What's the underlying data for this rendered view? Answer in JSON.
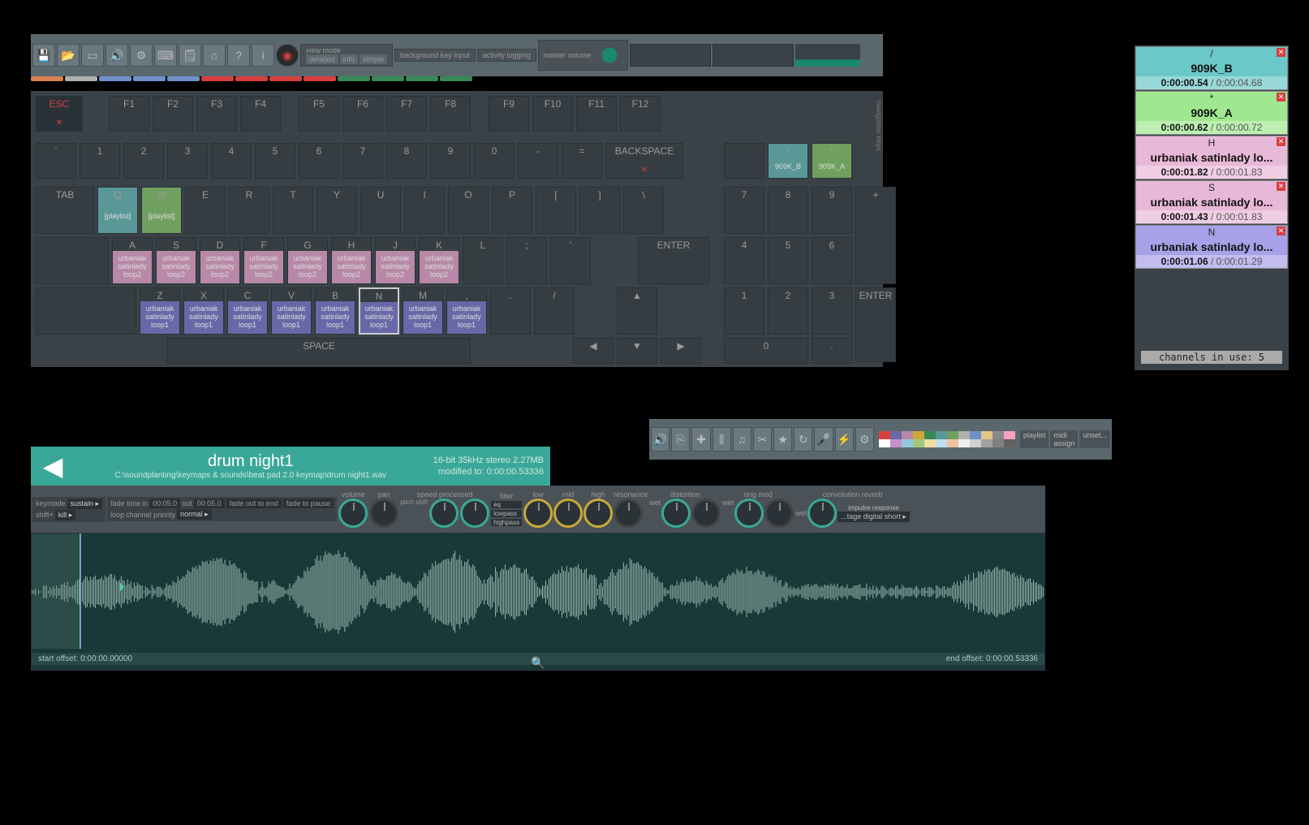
{
  "toolbar": {
    "view_mode_label": "view mode",
    "view_opts": [
      "detailed",
      "info",
      "simple"
    ],
    "bg_key_input": "background key input",
    "activity_logging": "activity logging",
    "master_volume": "master volume"
  },
  "fn_tabs": [
    "#d88050",
    "#b0b0b0",
    "#7090c8",
    "#7090c8",
    "#7090c8",
    "#d84040",
    "#d84040",
    "#d84040",
    "#d84040",
    "#388858",
    "#388858",
    "#388858",
    "#388858"
  ],
  "keyboard": {
    "esc": "ESC",
    "f_row": [
      "F1",
      "F2",
      "F3",
      "F4",
      "F5",
      "F6",
      "F7",
      "F8",
      "F9",
      "F10",
      "F11",
      "F12"
    ],
    "num_row": [
      "`",
      "1",
      "2",
      "3",
      "4",
      "5",
      "6",
      "7",
      "8",
      "9",
      "0",
      "-",
      "="
    ],
    "backspace": "BACKSPACE",
    "tab": "TAB",
    "q_row": [
      "Q",
      "W",
      "E",
      "R",
      "T",
      "Y",
      "U",
      "I",
      "O",
      "P",
      "[",
      "]",
      "\\"
    ],
    "a_row": [
      "A",
      "S",
      "D",
      "F",
      "G",
      "H",
      "J",
      "K",
      "L",
      ";",
      "'"
    ],
    "enter": "ENTER",
    "z_row": [
      "Z",
      "X",
      "C",
      "V",
      "B",
      "N",
      "M",
      ",",
      ".",
      "/"
    ],
    "space": "SPACE",
    "numpad_top": [
      "7",
      "8",
      "9"
    ],
    "numpad_mid": [
      "4",
      "5",
      "6",
      "+"
    ],
    "numpad_low": [
      "1",
      "2",
      "3"
    ],
    "numpad_bot": [
      "0",
      ".",
      "ENTER"
    ],
    "arrows": [
      "◀",
      "▼",
      "▶",
      "▲"
    ],
    "nav_label": "navigation keys",
    "playlist": "[playlist]",
    "slash_key": "/",
    "star_key": "*",
    "slash_name": "909K_B",
    "star_name": "909K_A",
    "loop2": "urbaniak satinlady loop2",
    "loop1": "urbaniak satinlady loop1"
  },
  "channels": {
    "rows": [
      {
        "key": "/",
        "name": "909K_B",
        "cur": "0:00:00.54",
        "tot": "0:00:04.68",
        "color": "teal"
      },
      {
        "key": "*",
        "name": "909K_A",
        "cur": "0:00:00.62",
        "tot": "0:00:00.72",
        "color": "green"
      },
      {
        "key": "H",
        "name": "urbaniak satinlady lo...",
        "cur": "0:00:01.82",
        "tot": "0:00:01.83",
        "color": "pink"
      },
      {
        "key": "S",
        "name": "urbaniak satinlady lo...",
        "cur": "0:00:01.43",
        "tot": "0:00:01.83",
        "color": "pink"
      },
      {
        "key": "N",
        "name": "urbaniak satinlady lo...",
        "cur": "0:00:01.06",
        "tot": "0:00:01.29",
        "color": "purple"
      }
    ],
    "footer": "channels in use: 5"
  },
  "midtool": {
    "labels": [
      "low",
      "mid",
      "high",
      "resonance",
      "distortion",
      "ring mod",
      "convolution reverb"
    ],
    "playlist_label": "playlist",
    "midi_label": "midi assign",
    "unset_label": "unset...",
    "colors": [
      "#d84040",
      "#6868a8",
      "#b888a8",
      "#caa838",
      "#388858",
      "#5a9898",
      "#70a060",
      "#b0b0b0",
      "#7090c8",
      "#e0c888",
      "#888",
      "#f8a0c0",
      "#fff",
      "#c890c8",
      "#90c8e0",
      "#a0c880",
      "#f0e0a0",
      "#c0e0f0",
      "#f0c0a0",
      "#f0f0f0",
      "#d0d0d0",
      "#a0a0a0",
      "#808080",
      "#606060"
    ]
  },
  "editor": {
    "title": "drum night1",
    "path": "C:\\soundplanting\\keymaps & sounds\\beat pad 2.0 keymap\\drum night1.wav",
    "info1": "16-bit 35kHz stereo 2.27MB",
    "info2": "modified to: 0:00:00.53336"
  },
  "params": {
    "keymode": "keymode",
    "keymode_val": "sustain ▸",
    "shift": "shift+",
    "shift_val": "kill ▸",
    "fadetime": "fade time",
    "in_label": "in",
    "in_val": "00:05.0",
    "out_label": "out",
    "out_val": "00:05.0",
    "fadeout_end": "fade out to end",
    "fadeto_pause": "fade to pause",
    "loop": "loop",
    "chprio": "channel priority",
    "chprio_val": "normal ▸",
    "volume": "volume",
    "pan": "pan",
    "speed": "speed",
    "processed": "processed",
    "pitchshift": "pitch shift",
    "filter": "filter",
    "eq": "eq",
    "lowpass": "lowpass",
    "highpass": "highpass",
    "low": "low",
    "mid": "mid",
    "high": "high",
    "resonance": "resonance",
    "distortion": "distortion",
    "ringmod": "ring mod",
    "convrev": "convolution reverb",
    "wet": "wet",
    "impulse": "impulse response",
    "impulse_val": "...tage digital short ▸"
  },
  "waveform": {
    "start_offset_label": "start offset:",
    "start_offset": "0:00:00.00000",
    "end_offset_label": "end offset:",
    "end_offset": "0:00:00.53336"
  }
}
